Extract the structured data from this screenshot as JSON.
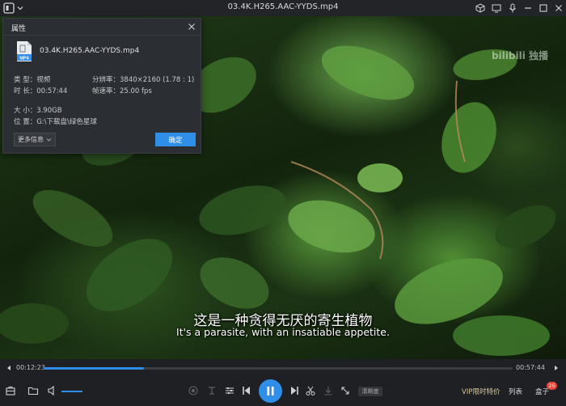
{
  "window": {
    "title": "03.4K.H265.AAC-YYDS.mp4"
  },
  "video": {
    "watermark": "bilibili 独播",
    "subtitle_cn": "这是一种贪得无厌的寄生植物",
    "subtitle_en": "It's a parasite, with an insatiable appetite."
  },
  "properties_dialog": {
    "title": "属性",
    "file_type_label": "MP4",
    "file_name": "03.4K.H265.AAC-YYDS.mp4",
    "type": "类 型：视频",
    "resolution": "分辨率：3840×2160 (1.78 : 1)",
    "duration": "时 长：00:57:44",
    "frame_rate": "帧速率：25.00 fps",
    "size": "大 小：3.90GB",
    "location": "位 置：G:\\下载盘\\绿色星球",
    "more_info_label": "更多信息",
    "ok_label": "确定"
  },
  "playback": {
    "current_time": "00:12:23",
    "total_time": "00:57:44",
    "progress_fraction": 0.2145,
    "volume_fraction": 1.0
  },
  "controls": {
    "clarity_label": "清晰度",
    "vip_label": "VIP限时特价",
    "list_label": "列表",
    "box_label": "盒子",
    "box_badge": "26"
  },
  "colors": {
    "accent": "#2f8fe8",
    "badge": "#e8453c",
    "background": "#1e2024"
  }
}
